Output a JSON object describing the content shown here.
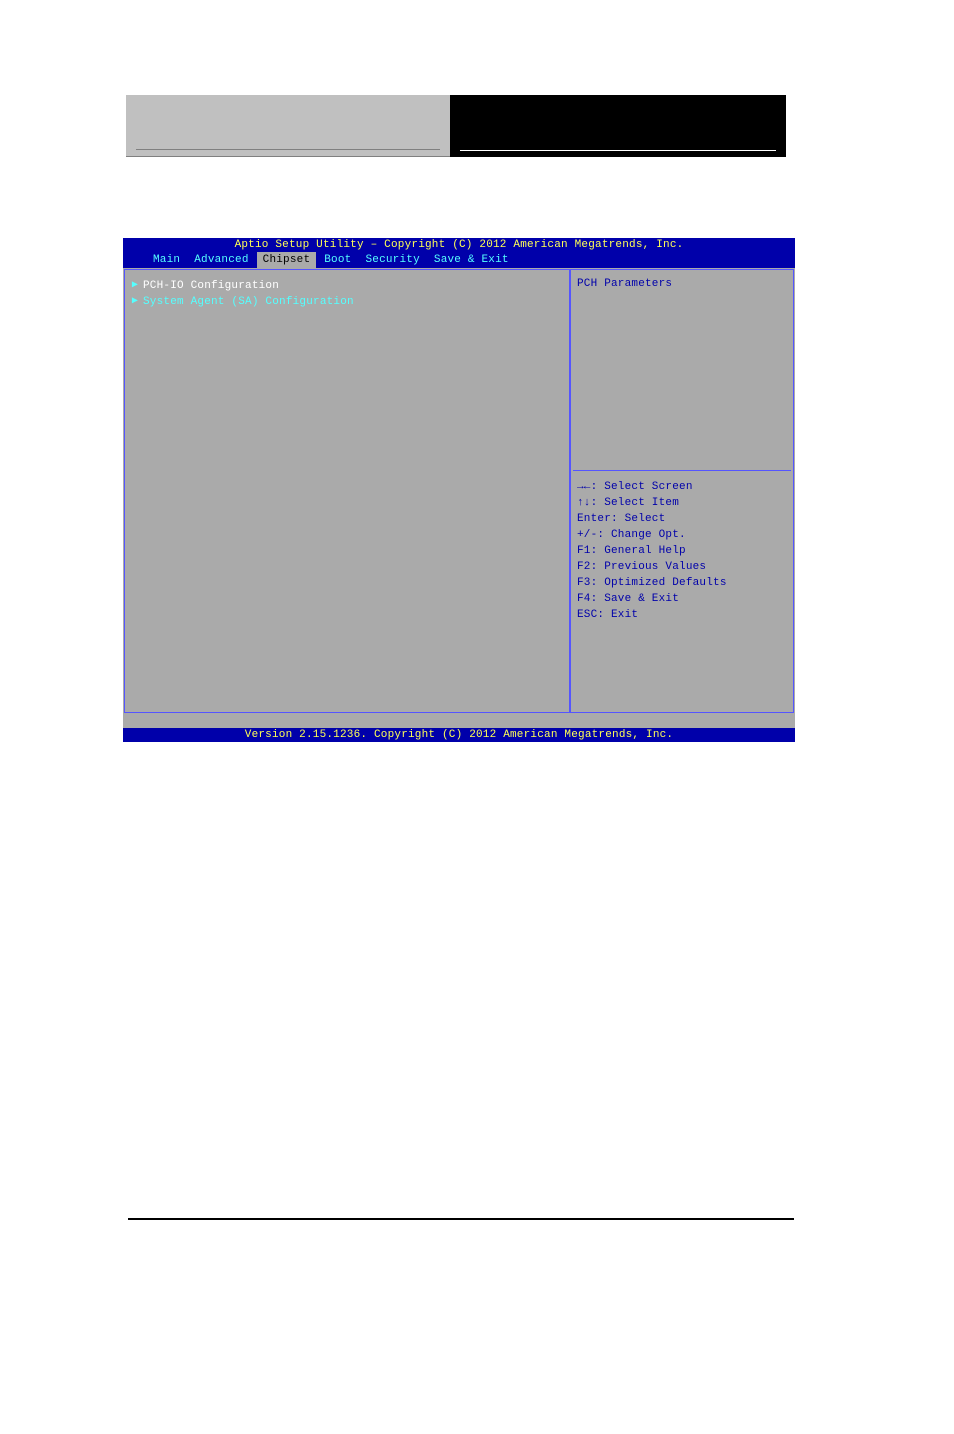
{
  "bios": {
    "title_top": "Aptio Setup Utility – Copyright (C) 2012 American Megatrends, Inc.",
    "tabs": {
      "main": "Main",
      "advanced": "Advanced",
      "chipset": "Chipset",
      "boot": "Boot",
      "security": "Security",
      "save_exit": "Save & Exit"
    },
    "menu_items": [
      {
        "label": "PCH-IO Configuration",
        "selected": true
      },
      {
        "label": "System Agent (SA) Configuration",
        "selected": false
      }
    ],
    "help_text": "PCH Parameters",
    "key_help": {
      "select_screen": "→←: Select Screen",
      "select_item": "↑↓: Select Item",
      "enter": "Enter: Select",
      "change_opt": "+/-: Change Opt.",
      "f1": "F1: General Help",
      "f2": "F2: Previous Values",
      "f3": "F3: Optimized Defaults",
      "f4": "F4: Save & Exit",
      "esc": "ESC: Exit"
    },
    "version_bottom": "Version 2.15.1236. Copyright (C) 2012 American Megatrends, Inc."
  }
}
